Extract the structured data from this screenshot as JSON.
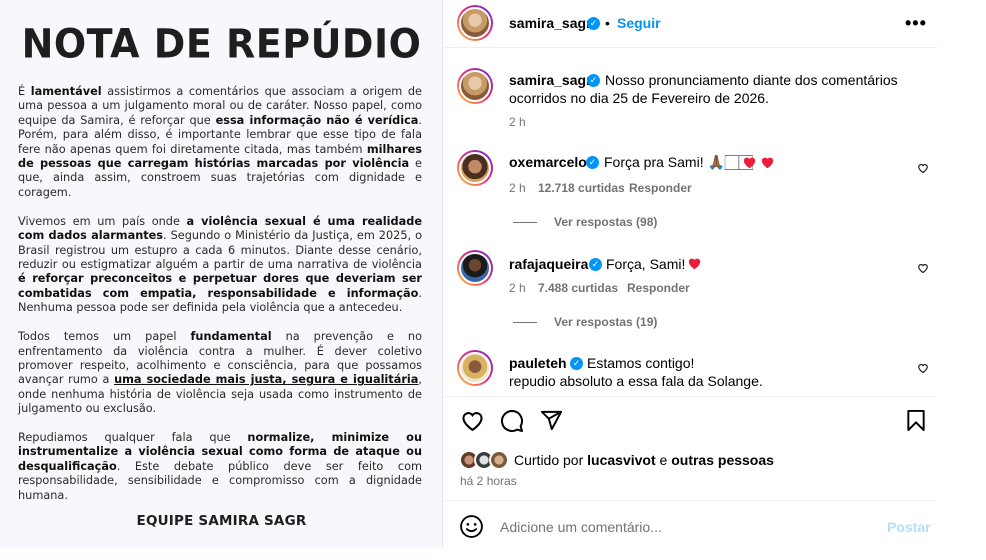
{
  "image": {
    "title": "NOTA DE REPÚDIO",
    "p1": [
      {
        "t": "É ",
        "s": ""
      },
      {
        "t": "lamentável",
        "s": "b"
      },
      {
        "t": " assistirmos a comentários que associam a origem de uma pessoa a um julgamento moral ou de caráter. Nosso papel, como equipe da Samira, é reforçar que ",
        "s": ""
      },
      {
        "t": "essa informação não é verídica",
        "s": "b"
      },
      {
        "t": ". Porém, para além disso, é importante lembrar que esse tipo de fala fere não apenas quem foi diretamente citada, mas também ",
        "s": ""
      },
      {
        "t": "milhares de pessoas que carregam histórias marcadas por violência",
        "s": "b"
      },
      {
        "t": " e que, ainda assim, constroem suas trajetórias com dignidade e coragem.",
        "s": ""
      }
    ],
    "p2": [
      {
        "t": "Vivemos em um país onde ",
        "s": ""
      },
      {
        "t": "a violência sexual é uma realidade com dados alarmantes",
        "s": "b"
      },
      {
        "t": ". Segundo o Ministério da Justiça, em 2025, o Brasil registrou um estupro a cada 6 minutos. Diante desse cenário, reduzir ou estigmatizar alguém a partir de uma narrativa de violência ",
        "s": ""
      },
      {
        "t": "é reforçar preconceitos e perpetuar dores que deveriam ser combatidas com empatia, responsabilidade e informação",
        "s": "b"
      },
      {
        "t": ". Nenhuma pessoa pode ser definida pela violência que a antecedeu.",
        "s": ""
      }
    ],
    "p3": [
      {
        "t": "Todos temos um papel ",
        "s": ""
      },
      {
        "t": "fundamental",
        "s": "b"
      },
      {
        "t": " na prevenção e no enfrentamento da violência contra a mulher. É dever coletivo promover respeito, acolhimento e consciência, para que possamos avançar rumo a ",
        "s": ""
      },
      {
        "t": "uma sociedade mais justa, segura e igualitária",
        "s": "bu"
      },
      {
        "t": ", onde nenhuma história de violência seja usada como instrumento de julgamento ou exclusão.",
        "s": ""
      }
    ],
    "p4": [
      {
        "t": "Repudiamos qualquer fala que ",
        "s": ""
      },
      {
        "t": "normalize, minimize ou instrumentalize a violência sexual como forma de ataque ou desqualificação",
        "s": "b"
      },
      {
        "t": ". Este debate público deve ser feito com responsabilidade, sensibilidade e compromisso com a dignidade humana.",
        "s": ""
      }
    ],
    "signature": "EQUIPE SAMIRA SAGR"
  },
  "header": {
    "username": "samira_sagr",
    "dot": "•",
    "follow_label": "Seguir",
    "more_label": "•••"
  },
  "caption": {
    "username": "samira_sagr",
    "text_line1": "Nosso pronunciamento diante dos comentários",
    "text_line2": "ocorridos no dia 25 de Fevereiro de 2026.",
    "time": "2 h"
  },
  "comments": [
    {
      "username": "oxemarcelo",
      "text": "Força pra Sami! 🙏🏾🏻🏻",
      "time": "2 h",
      "likes": "12.718 curtidas",
      "reply_label": "Responder",
      "view_replies": "Ver respostas (98)"
    },
    {
      "username": "rafajaqueira",
      "text": "Força, Sami!",
      "time": "2 h",
      "likes": "7.488 curtidas",
      "reply_label": "Responder",
      "view_replies": "Ver respostas (19)"
    },
    {
      "username": "pauleteh",
      "text_line1": "Estamos contigo!",
      "text_line2": "repudio absoluto a essa fala da Solange."
    }
  ],
  "likes_summary": {
    "prefix": "Curtido por",
    "user": "lucasvivot",
    "mid": "e",
    "suffix": "outras pessoas",
    "time_ago": "há 2 horas"
  },
  "composer": {
    "placeholder": "Adicione um comentário...",
    "post_label": "Postar"
  },
  "colors": {
    "accent": "#0095f6",
    "heart": "#ed1c3b",
    "muted": "#737373"
  }
}
